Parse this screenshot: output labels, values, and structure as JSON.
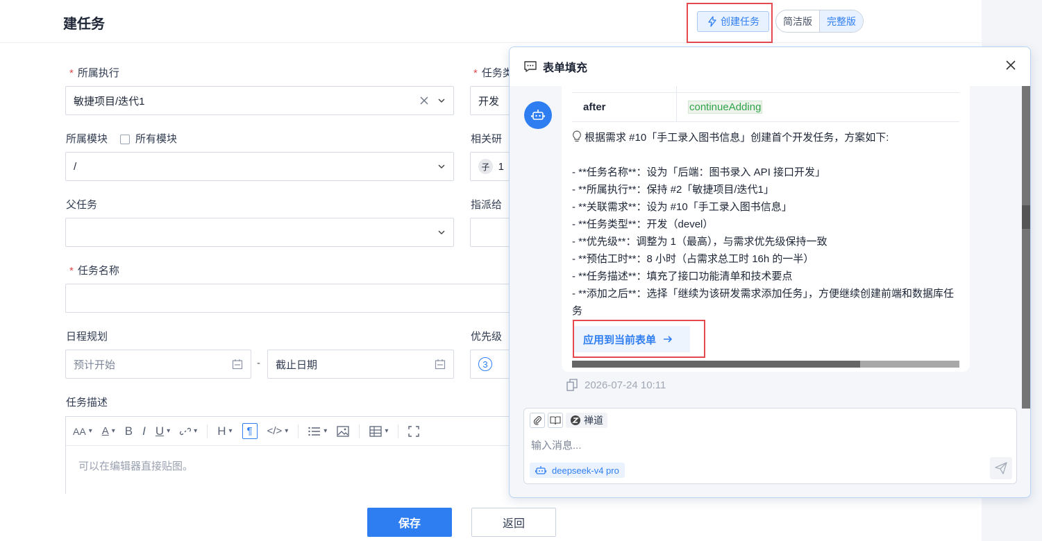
{
  "page": {
    "title": "建任务",
    "create_task_label": "创建任务",
    "mode_simple": "简洁版",
    "mode_full": "完整版"
  },
  "form": {
    "execution_label": "所属执行",
    "execution_value": "敏捷项目/迭代1",
    "task_type_label": "任务类",
    "task_type_value": "开发",
    "module_label": "所属模块",
    "all_modules_label": "所有模块",
    "module_value": "/",
    "related_label": "相关研",
    "related_badge": "子",
    "related_value": "1",
    "parent_label": "父任务",
    "assign_label": "指派给",
    "task_name_label": "任务名称",
    "schedule_label": "日程规划",
    "start_placeholder": "预计开始",
    "date_dash": "-",
    "end_placeholder": "截止日期",
    "priority_label": "优先级",
    "priority_value": "3",
    "desc_label": "任务描述",
    "editor_placeholder": "可以在编辑器直接贴图。",
    "save_label": "保存",
    "back_label": "返回"
  },
  "toolbar": {
    "font_size": "AA",
    "font_color": "A",
    "bold": "B",
    "italic": "I",
    "underline": "U",
    "heading": "H",
    "paragraph": "¶",
    "code": "</>"
  },
  "chat": {
    "title": "表单填充",
    "table_key": "after",
    "table_value": "continueAdding",
    "intro": "根据需求 #10「手工录入图书信息」创建首个开发任务，方案如下:",
    "items": [
      "- **任务名称**：设为「后端：图书录入 API 接口开发」",
      "- **所属执行**：保持 #2「敏捷项目/迭代1」",
      "- **关联需求**：设为 #10「手工录入图书信息」",
      "- **任务类型**：开发（devel）",
      "- **优先级**：调整为 1（最高），与需求优先级保持一致",
      "- **预估工时**：8 小时（占需求总工时 16h 的一半）",
      "- **任务描述**：填充了接口功能清单和技术要点",
      "- **添加之后**：选择「继续为该研发需求添加任务」，方便继续创建前端和数据库任务"
    ],
    "apply_label": "应用到当前表单",
    "timestamp": "2026-07-24 10:11",
    "tool_zen": "禅道",
    "input_placeholder": "输入消息...",
    "model": "deepseek-v4 pro"
  },
  "colors": {
    "accent": "#2e7ef2",
    "highlight": "#e5484d"
  }
}
